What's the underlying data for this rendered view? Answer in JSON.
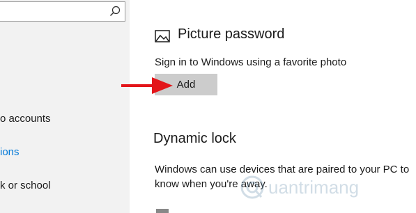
{
  "sidebar": {
    "search": {
      "placeholder": "",
      "value": ""
    },
    "items": [
      {
        "label": "o accounts",
        "active": false
      },
      {
        "label": "ions",
        "active": true
      },
      {
        "label": "k or school",
        "active": false
      }
    ]
  },
  "picture_password": {
    "title": "Picture password",
    "description": "Sign in to Windows using a favorite photo",
    "add_label": "Add"
  },
  "dynamic_lock": {
    "title": "Dynamic lock",
    "description_line1": "Windows can use devices that are paired to your PC to",
    "description_line2": "know when you're away."
  },
  "watermark": {
    "text": "uantrimang"
  },
  "colors": {
    "sidebar_bg": "#f2f2f2",
    "accent": "#0078d7",
    "button_bg": "#cccccc",
    "arrow": "#e3151a"
  }
}
